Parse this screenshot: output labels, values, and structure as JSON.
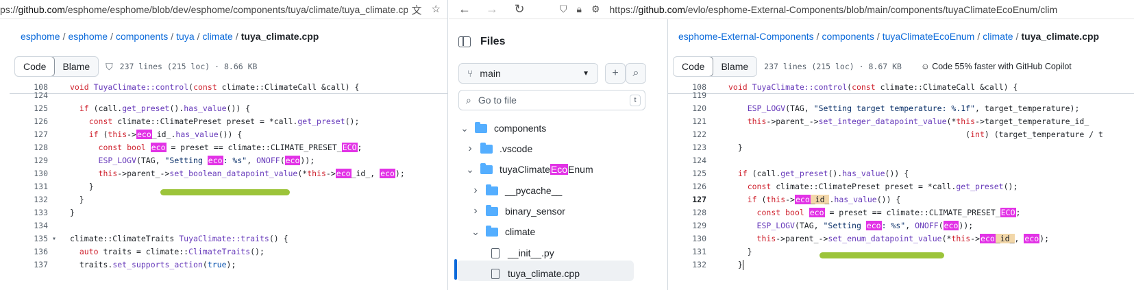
{
  "left": {
    "url": {
      "prefix": "ps://",
      "host": "github.com",
      "path": "/esphome/esphome/blob/dev/esphome/components/tuya/climate/tuya_climate.cpp"
    },
    "breadcrumb": [
      "esphome",
      "esphome",
      "components",
      "tuya",
      "climate"
    ],
    "breadcrumb_current": "tuya_climate.cpp",
    "tabs": {
      "code": "Code",
      "blame": "Blame"
    },
    "meta": "237 lines (215 loc) · 8.66 KB",
    "sticky_line": {
      "num": "108",
      "text": "void TuyaClimate::control(const climate::ClimateCall &call) {"
    },
    "lines": [
      {
        "num": "124",
        "html": ""
      },
      {
        "num": "125",
        "html": "  <span class=\"kw\">if</span> (call.<span class=\"fn\">get_preset</span>().<span class=\"fn\">has_value</span>()) {"
      },
      {
        "num": "126",
        "html": "    <span class=\"kw\">const</span> climate::ClimatePreset preset = *call.<span class=\"fn\">get_preset</span>();"
      },
      {
        "num": "127",
        "html": "    <span class=\"kw\">if</span> (<span class=\"kw\">this</span>-&gt;<span class=\"hl\">eco</span>_id_.<span class=\"fn\">has_value</span>()) {"
      },
      {
        "num": "128",
        "html": "      <span class=\"kw\">const</span> <span class=\"kw\">bool</span> <span class=\"hl\">eco</span> = preset == climate::CLIMATE_PRESET_<span class=\"hl\">ECO</span>;"
      },
      {
        "num": "129",
        "html": "      <span class=\"fn\">ESP_LOGV</span>(TAG, <span class=\"str\">\"Setting <span class=\"hl\">eco</span>: %s\"</span>, <span class=\"fn\">ONOFF</span>(<span class=\"hl\">eco</span>));"
      },
      {
        "num": "130",
        "html": "      <span class=\"kw\">this</span>-&gt;parent_-&gt;<span class=\"fn\">set_boolean_datapoint_value</span>(*<span class=\"kw\">this</span>-&gt;<span class=\"hl\">eco</span>_id_, <span class=\"hl\">eco</span>);"
      },
      {
        "num": "131",
        "html": "    }"
      },
      {
        "num": "132",
        "html": "  }"
      },
      {
        "num": "133",
        "html": "}"
      },
      {
        "num": "134",
        "html": ""
      },
      {
        "num": "135",
        "html": "climate::ClimateTraits <span class=\"fn\">TuyaClimate::traits</span>() {"
      },
      {
        "num": "136",
        "html": "  <span class=\"kw\">auto</span> traits = climate::<span class=\"fn\">ClimateTraits</span>();"
      },
      {
        "num": "137",
        "html": "  traits.<span class=\"fn\">set_supports_action</span>(<span class=\"cn\">true</span>);"
      }
    ]
  },
  "right": {
    "url": {
      "prefix": "https://",
      "host": "github.com",
      "path": "/evlo/esphome-External-Components/blob/main/components/tuyaClimateEcoEnum/clim"
    },
    "files": {
      "title": "Files",
      "branch": "main",
      "search_placeholder": "Go to file",
      "shortcut": "t",
      "tree": [
        {
          "label": "components",
          "kind": "folder",
          "open": true,
          "depth": 0
        },
        {
          "label": ".vscode",
          "kind": "folder",
          "open": false,
          "depth": 1
        },
        {
          "label_pre": "tuyaClimate",
          "label_hl": "Eco",
          "label_post": "Enum",
          "kind": "folder",
          "open": true,
          "depth": 1
        },
        {
          "label": "__pycache__",
          "kind": "folder",
          "open": false,
          "depth": 2
        },
        {
          "label": "binary_sensor",
          "kind": "folder",
          "open": false,
          "depth": 2
        },
        {
          "label": "climate",
          "kind": "folder",
          "open": true,
          "depth": 2
        },
        {
          "label": "__init__.py",
          "kind": "file",
          "depth": 3
        },
        {
          "label": "tuya_climate.cpp",
          "kind": "file",
          "depth": 3
        }
      ]
    },
    "breadcrumb": [
      "esphome-External-Components",
      "components",
      "tuyaClimateEcoEnum",
      "climate"
    ],
    "breadcrumb_current": "tuya_climate.cpp",
    "tabs": {
      "code": "Code",
      "blame": "Blame"
    },
    "meta": "237 lines (215 loc) · 8.67 KB",
    "copilot": "Code 55% faster with GitHub Copilot",
    "sticky_line": {
      "num": "108",
      "text": "void TuyaClimate::control(const climate::ClimateCall &call) {"
    },
    "lines": [
      {
        "num": "119",
        "html": ""
      },
      {
        "num": "120",
        "html": "    <span class=\"fn\">ESP_LOGV</span>(TAG, <span class=\"str\">\"Setting target temperature: %.1f\"</span>, target_temperature);"
      },
      {
        "num": "121",
        "html": "    <span class=\"kw\">this</span>-&gt;parent_-&gt;<span class=\"fn\">set_integer_datapoint_value</span>(*<span class=\"kw\">this</span>-&gt;target_temperature_id_"
      },
      {
        "num": "122",
        "html": "                                                  (<span class=\"kw\">int</span>) (target_temperature / t"
      },
      {
        "num": "123",
        "html": "  }"
      },
      {
        "num": "124",
        "html": ""
      },
      {
        "num": "125",
        "html": "  <span class=\"kw\">if</span> (call.<span class=\"fn\">get_preset</span>().<span class=\"fn\">has_value</span>()) {"
      },
      {
        "num": "126",
        "html": "    <span class=\"kw\">const</span> climate::ClimatePreset preset = *call.<span class=\"fn\">get_preset</span>();"
      },
      {
        "num": "127",
        "html": "    <span class=\"kw\">if</span> (<span class=\"kw\">this</span>-&gt;<span class=\"hlo\"><span class=\"hl\">eco</span>_id_</span>.<span class=\"fn\">has_value</span>()) {",
        "current": true
      },
      {
        "num": "128",
        "html": "      <span class=\"kw\">const</span> <span class=\"kw\">bool</span> <span class=\"hl\">eco</span> = preset == climate::CLIMATE_PRESET_<span class=\"hl\">ECO</span>;"
      },
      {
        "num": "129",
        "html": "      <span class=\"fn\">ESP_LOGV</span>(TAG, <span class=\"str\">\"Setting <span class=\"hl\">eco</span>: %s\"</span>, <span class=\"fn\">ONOFF</span>(<span class=\"hl\">eco</span>));"
      },
      {
        "num": "130",
        "html": "      <span class=\"kw\">this</span>-&gt;parent_-&gt;<span class=\"fn\">set_enum_datapoint_value</span>(*<span class=\"kw\">this</span>-&gt;<span class=\"hlo\"><span class=\"hl\">eco</span>_id_</span>, <span class=\"hl\">eco</span>);"
      },
      {
        "num": "131",
        "html": "    }"
      },
      {
        "num": "132",
        "html": "  }<span class=\"cursor\"></span>"
      }
    ]
  },
  "icons": {
    "translate": "translate-icon",
    "star": "star-icon",
    "back": "back-arrow-icon",
    "forward": "forward-arrow-icon",
    "reload": "reload-icon",
    "shield": "shield-icon",
    "lock": "lock-icon",
    "permissions": "permissions-icon"
  },
  "colors": {
    "link": "#0969da",
    "highlight": "#e233e6",
    "underline_marker": "#9cc43a",
    "folder": "#54aeff"
  }
}
